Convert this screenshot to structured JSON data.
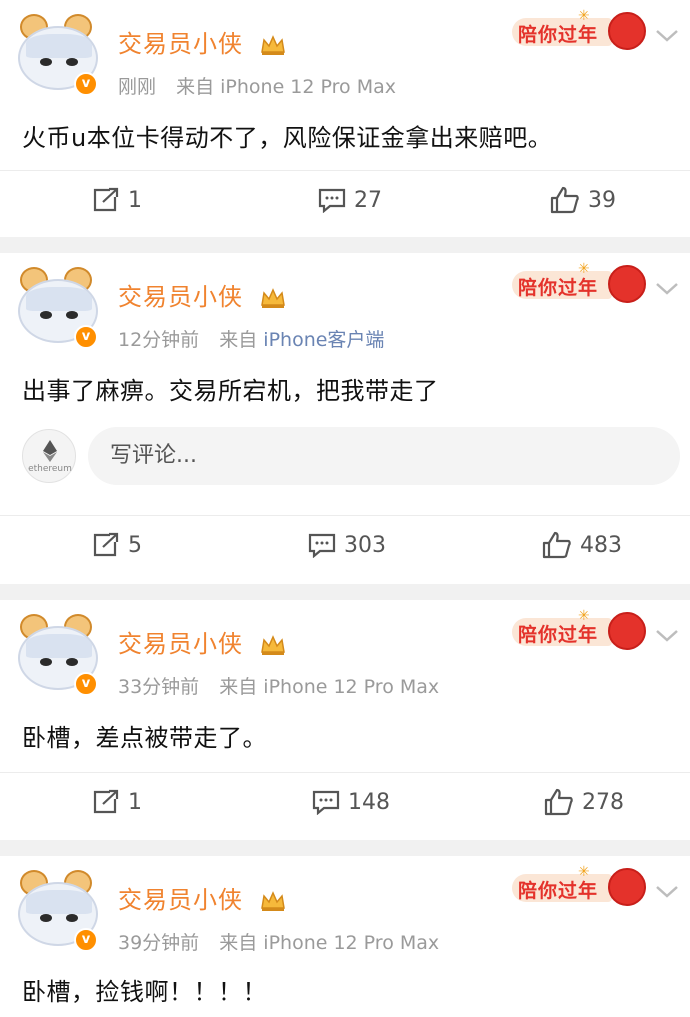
{
  "colors": {
    "username": "#f0832f",
    "meta_gray": "#9a9a9a",
    "source_link": "#6a84b3",
    "festival_red": "#e4322b",
    "verified_badge": "#ff8f00",
    "separator": "#f1f1f1"
  },
  "badge": {
    "festival_text": "陪你过年",
    "verified_mark": "v"
  },
  "posts": [
    {
      "username": "交易员小侠",
      "time": "刚刚",
      "source_prefix": "来自",
      "source": "iPhone 12 Pro Max",
      "content": "火币u本位卡得动不了，风险保证金拿出来赔吧。",
      "reposts": "1",
      "comments": "27",
      "likes": "39"
    },
    {
      "username": "交易员小侠",
      "time": "12分钟前",
      "source_prefix": "来自",
      "source": "iPhone客户端",
      "content": "出事了麻痹。交易所宕机，把我带走了",
      "comment_placeholder": "写评论...",
      "commenter_avatar_label": "ethereum",
      "reposts": "5",
      "comments": "303",
      "likes": "483"
    },
    {
      "username": "交易员小侠",
      "time": "33分钟前",
      "source_prefix": "来自",
      "source": "iPhone 12 Pro Max",
      "content": "卧槽，差点被带走了。",
      "reposts": "1",
      "comments": "148",
      "likes": "278"
    },
    {
      "username": "交易员小侠",
      "time": "39分钟前",
      "source_prefix": "来自",
      "source": "iPhone 12 Pro Max",
      "content": "卧槽，捡钱啊！！！！"
    }
  ]
}
